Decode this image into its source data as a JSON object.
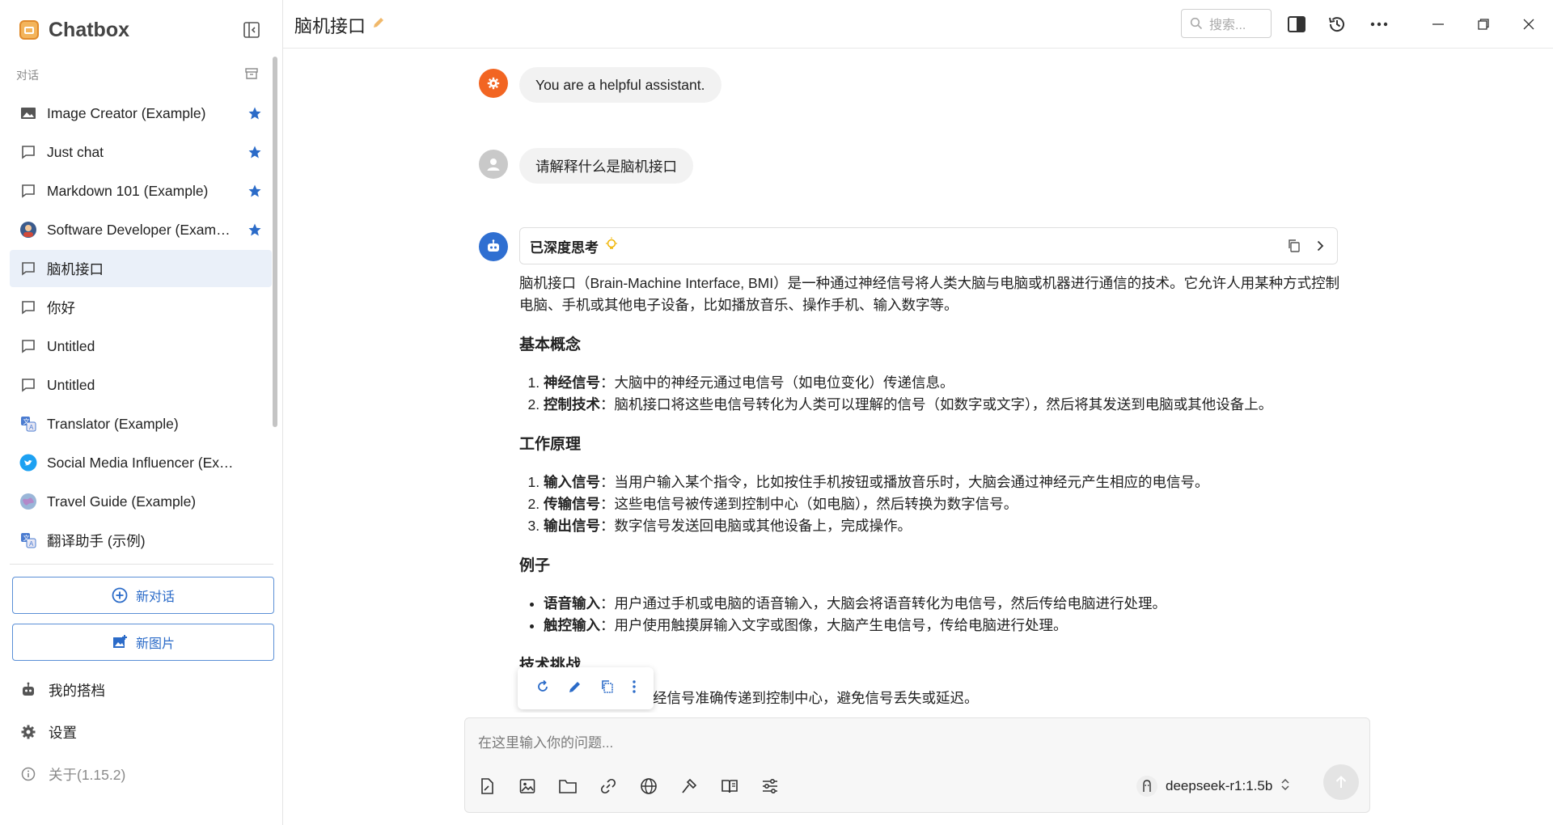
{
  "app": {
    "name": "Chatbox",
    "version_label": "关于(1.15.2)"
  },
  "sidebar": {
    "section_label": "对话",
    "items": [
      {
        "label": "Image Creator (Example)",
        "icon": "image-icon",
        "starred": true
      },
      {
        "label": "Just chat",
        "icon": "chat-bubble-icon",
        "starred": true
      },
      {
        "label": "Markdown 101 (Example)",
        "icon": "chat-bubble-icon",
        "starred": true
      },
      {
        "label": "Software Developer (Example)",
        "icon": "developer-avatar-icon",
        "starred": true
      },
      {
        "label": "脑机接口",
        "icon": "chat-bubble-icon",
        "starred": false,
        "active": true
      },
      {
        "label": "你好",
        "icon": "chat-bubble-icon",
        "starred": false
      },
      {
        "label": "Untitled",
        "icon": "chat-bubble-icon",
        "starred": false
      },
      {
        "label": "Untitled",
        "icon": "chat-bubble-icon",
        "starred": false
      },
      {
        "label": "Translator (Example)",
        "icon": "translate-icon",
        "starred": false
      },
      {
        "label": "Social Media Influencer (Example)",
        "icon": "twitter-icon",
        "starred": false
      },
      {
        "label": "Travel Guide (Example)",
        "icon": "globe-avatar-icon",
        "starred": false
      },
      {
        "label": "翻译助手 (示例)",
        "icon": "translate-icon",
        "starred": false
      }
    ],
    "new_chat_label": "新对话",
    "new_image_label": "新图片",
    "my_copilots_label": "我的搭档",
    "settings_label": "设置"
  },
  "header": {
    "title": "脑机接口",
    "search_placeholder": "搜索..."
  },
  "chat": {
    "system_message": "You are a helpful assistant.",
    "user_message": "请解释什么是脑机接口",
    "thinking_label": "已深度思考",
    "answer": {
      "intro": "脑机接口（Brain-Machine Interface, BMI）是一种通过神经信号将人类大脑与电脑或机器进行通信的技术。它允许人用某种方式控制电脑、手机或其他电子设备，比如播放音乐、操作手机、输入数字等。",
      "h1": "基本概念",
      "concepts": [
        {
          "term": "神经信号",
          "desc": "：大脑中的神经元通过电信号（如电位变化）传递信息。"
        },
        {
          "term": "控制技术",
          "desc": "：脑机接口将这些电信号转化为人类可以理解的信号（如数字或文字），然后将其发送到电脑或其他设备上。"
        }
      ],
      "h2": "工作原理",
      "principles": [
        {
          "term": "输入信号",
          "desc": "：当用户输入某个指令，比如按住手机按钮或播放音乐时，大脑会通过神经元产生相应的电信号。"
        },
        {
          "term": "传输信号",
          "desc": "：这些电信号被传递到控制中心（如电脑），然后转换为数字信号。"
        },
        {
          "term": "输出信号",
          "desc": "：数字信号发送回电脑或其他设备上，完成操作。"
        }
      ],
      "h3": "例子",
      "examples": [
        {
          "term": "语音输入",
          "desc": "：用户通过手机或电脑的语音输入，大脑会将语音转化为电信号，然后传给电脑进行处理。"
        },
        {
          "term": "触控输入",
          "desc": "：用户使用触摸屏输入文字或图像，大脑产生电信号，传给电脑进行处理。"
        }
      ],
      "h4": "技术挑战",
      "partial_line": "经信号准确传递到控制中心，避免信号丢失或延迟。"
    }
  },
  "input": {
    "placeholder": "在这里输入你的问题...",
    "model": "deepseek-r1:1.5b"
  },
  "colors": {
    "accent_blue": "#2b6bc8",
    "system_avatar": "#f26522",
    "assistant_avatar": "#2f6fd1",
    "star": "#2b6bc8"
  }
}
